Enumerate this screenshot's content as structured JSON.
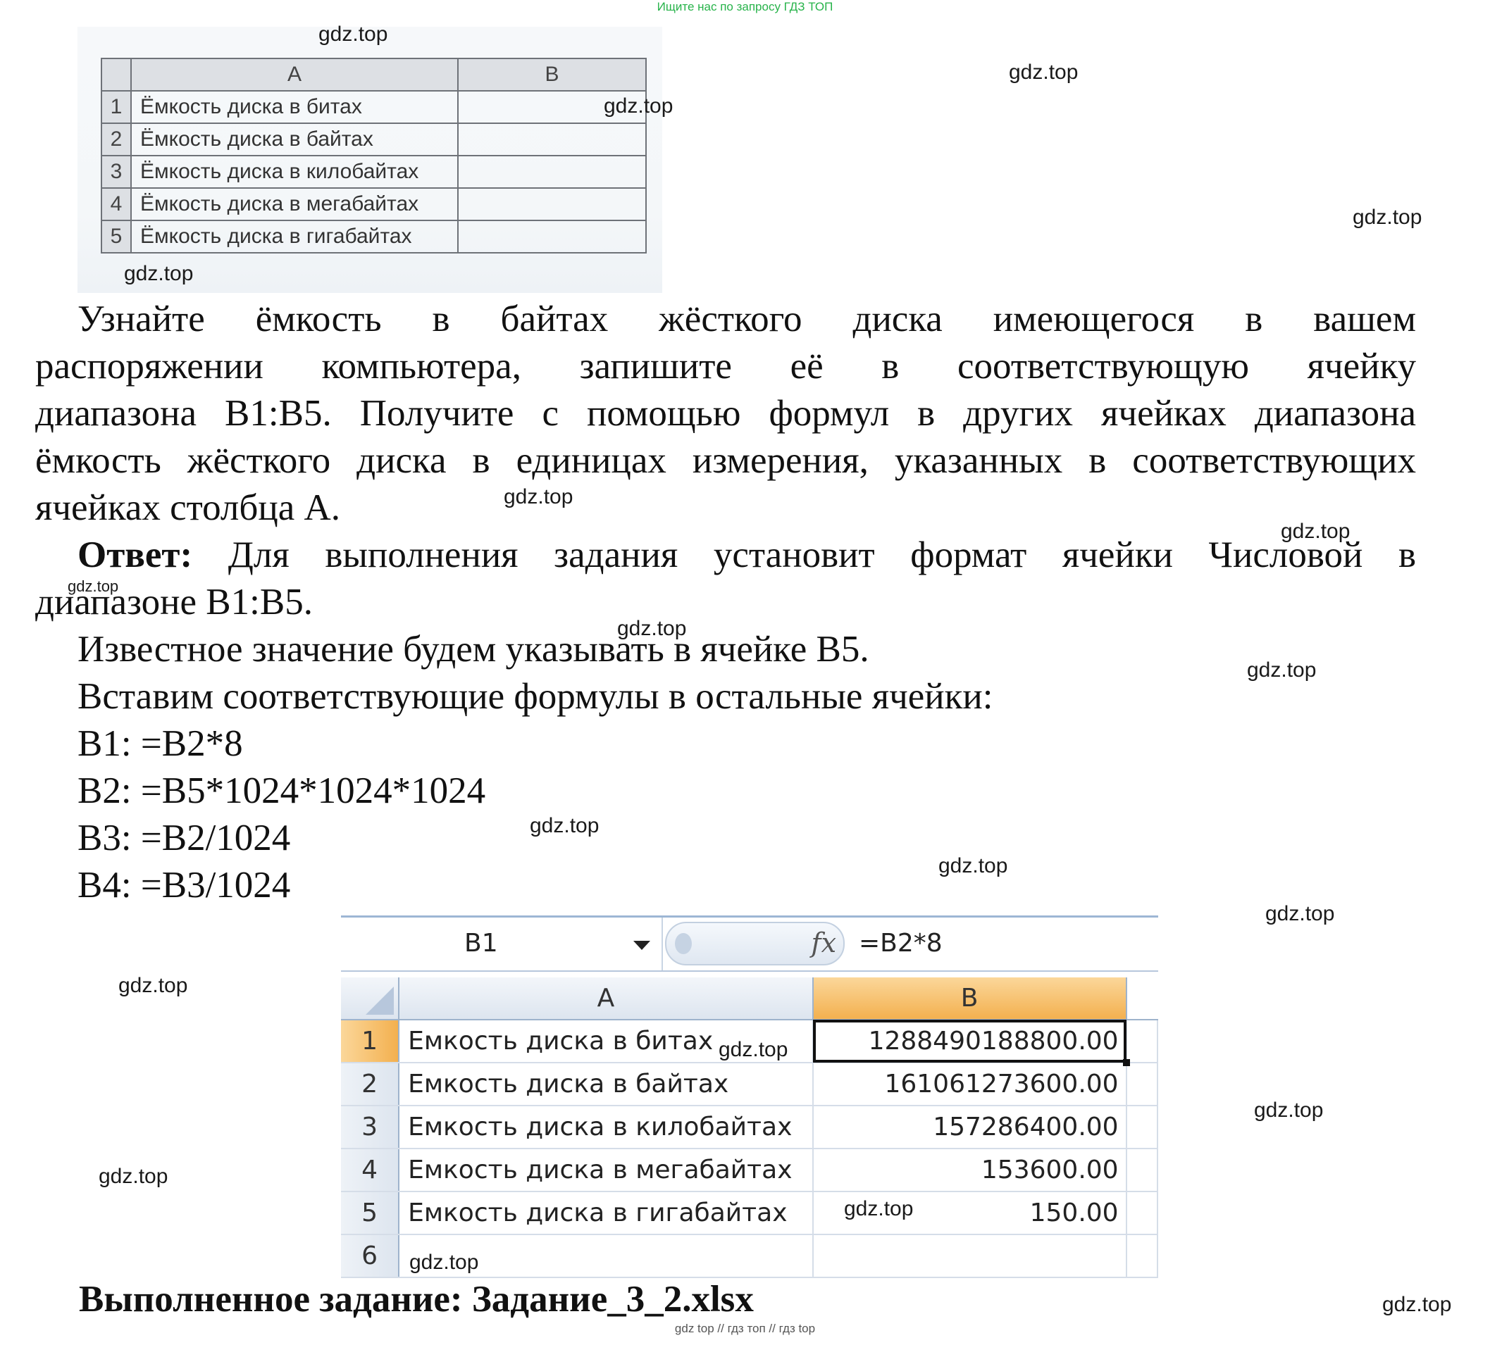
{
  "banner": "Ищите нас по запросу ГДЗ ТОП",
  "watermark": "gdz.top",
  "book_table": {
    "col_a": "A",
    "col_b": "B",
    "rows": [
      {
        "n": "1",
        "text": "Ёмкость диска в битах"
      },
      {
        "n": "2",
        "text": "Ёмкость диска в байтах"
      },
      {
        "n": "3",
        "text": "Ёмкость диска в килобайтах"
      },
      {
        "n": "4",
        "text": "Ёмкость диска в мегабайтах"
      },
      {
        "n": "5",
        "text": "Ёмкость диска в гигабайтах"
      }
    ]
  },
  "task": {
    "line1": "Узнайте ёмкость в байтах жёсткого диска имеющегося в вашем",
    "line2": "распоряжении компьютера, запишите её в соответствующую ячейку",
    "line3": "диапазона B1:B5. Получите с помощью формул в других ячейках диапазона",
    "line4": "ёмкость жёсткого диска в единицах измерения, указанных в соответствующих",
    "line5": "ячейках столбца А."
  },
  "answer": {
    "label": "Ответ:",
    "line1": "Для выполнения задания установит формат ячейки Числовой в",
    "line2": "диапазоне B1:B5.",
    "line3": "Известное значение будем указывать в ячейке B5.",
    "line4": "Вставим соответствующие формулы в остальные ячейки:",
    "formulas": [
      "B1: =B2*8",
      "B2: =B5*1024*1024*1024",
      "B3: =B2/1024",
      "B4: =B3/1024"
    ]
  },
  "excel": {
    "name_box": "B1",
    "fx": "fx",
    "formula": "=B2*8",
    "col_a": "A",
    "col_b": "B",
    "rows": [
      {
        "n": "1",
        "a": "Емкость диска в битах",
        "b": "1288490188800.00"
      },
      {
        "n": "2",
        "a": "Емкость диска в байтах",
        "b": "161061273600.00"
      },
      {
        "n": "3",
        "a": "Емкость диска в килобайтах",
        "b": "157286400.00"
      },
      {
        "n": "4",
        "a": "Емкость диска в мегабайтах",
        "b": "153600.00"
      },
      {
        "n": "5",
        "a": "Емкость диска в гигабайтах",
        "b": "150.00"
      },
      {
        "n": "6",
        "a": "",
        "b": ""
      }
    ]
  },
  "completed": {
    "label": "Выполненное задание:",
    "file": "Задание_3_2.xlsx"
  },
  "footer": "gdz top // гдз топ // гдз top"
}
